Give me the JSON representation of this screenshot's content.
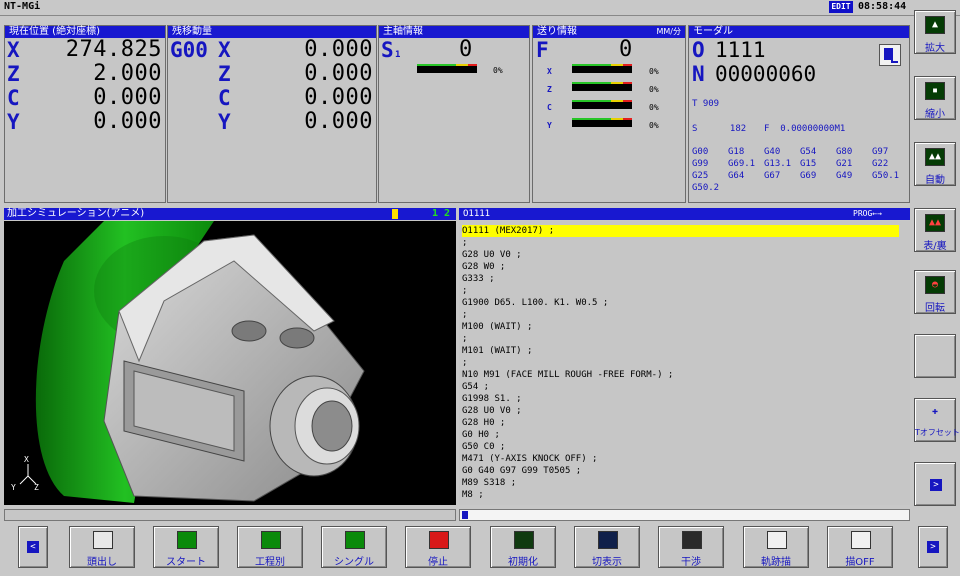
{
  "titlebar": {
    "app_name": "NT-MGi",
    "mode_badge": "EDIT",
    "clock": "08:58:44"
  },
  "position": {
    "title": "現在位置 (絶対座標)",
    "axes": [
      {
        "label": "X",
        "value": "274.825"
      },
      {
        "label": "Z",
        "value": "2.000"
      },
      {
        "label": "C",
        "value": "0.000"
      },
      {
        "label": "Y",
        "value": "0.000"
      }
    ]
  },
  "distance": {
    "title": "残移動量",
    "gcode": "G00",
    "axes": [
      {
        "label": "X",
        "value": "0.000"
      },
      {
        "label": "Z",
        "value": "0.000"
      },
      {
        "label": "C",
        "value": "0.000"
      },
      {
        "label": "Y",
        "value": "0.000"
      }
    ]
  },
  "spindle": {
    "title": "主軸情報",
    "label": "S",
    "subscript": "1",
    "value": "0",
    "load_percent": "0%"
  },
  "feed": {
    "title": "送り情報",
    "unit": "MM/分",
    "label": "F",
    "value": "0",
    "axes": [
      {
        "label": "X",
        "percent": "0%"
      },
      {
        "label": "Z",
        "percent": "0%"
      },
      {
        "label": "C",
        "percent": "0%"
      },
      {
        "label": "Y",
        "percent": "0%"
      }
    ]
  },
  "modal": {
    "title": "モーダル",
    "o_label": "O",
    "o_value": "1111",
    "n_label": "N",
    "n_value": "00000060",
    "t_line": "T  909",
    "s_line": "S      182",
    "f_line": "F  0.00000000M1",
    "gcodes": [
      [
        "G00",
        "G18",
        "G40",
        "G54",
        "G80",
        "G97"
      ],
      [
        "G99",
        "G69.1",
        "G13.1",
        "G15",
        "G21",
        "G22"
      ],
      [
        "G25",
        "G64",
        "G67",
        "G69",
        "G49",
        "G50.1"
      ],
      [
        "G50.2"
      ]
    ]
  },
  "simulation": {
    "title": "加工シミュレーション(アニメ)",
    "indicator": "1 2",
    "axis_x": "X",
    "axis_y": "Y",
    "axis_z": "Z"
  },
  "program": {
    "title": "O1111",
    "mode": "PROG←→",
    "lines": [
      "O1111 (MEX2017) ;",
      ";",
      "G28 U0 V0 ;",
      "G28 W0 ;",
      "G333 ;",
      ";",
      "G1900 D65. L100. K1. W0.5 ;",
      ";",
      "M100 (WAIT) ;",
      ";",
      "M101 (WAIT) ;",
      ";",
      "N10 M91 (FACE MILL ROUGH -FREE FORM-) ;",
      "G54 ;",
      "G1998 S1. ;",
      "G28 U0 V0 ;",
      "G28 H0 ;",
      "G0 H0 ;",
      "G50 C0 ;",
      "M471 (Y-AXIS KNOCK OFF) ;",
      "G0 G40 G97 G99 T0505 ;",
      "M89 S318 ;",
      "M8 ;"
    ]
  },
  "side_buttons": [
    {
      "label": "拡大",
      "icon": "zoom-in-icon"
    },
    {
      "label": "縮小",
      "icon": "zoom-out-icon"
    },
    {
      "label": "自動",
      "icon": "auto-icon"
    },
    {
      "label": "表/裏",
      "icon": "front-back-icon"
    },
    {
      "label": "回転",
      "icon": "rotate-icon"
    },
    {
      "label": "",
      "icon": ""
    },
    {
      "label": "Tオフセット",
      "icon": "tool-offset-icon"
    },
    {
      "label": "",
      "icon": "next-arrow-icon"
    }
  ],
  "soft_buttons": [
    {
      "label": "頭出し",
      "icon": "search-head-icon"
    },
    {
      "label": "スタート",
      "icon": "play-icon"
    },
    {
      "label": "工程別",
      "icon": "step-icon"
    },
    {
      "label": "シングル",
      "icon": "single-block-icon"
    },
    {
      "label": "停止",
      "icon": "stop-icon"
    },
    {
      "label": "初期化",
      "icon": "reset-icon"
    },
    {
      "label": "切表示",
      "icon": "cut-display-icon"
    },
    {
      "label": "干渉",
      "icon": "interference-icon"
    },
    {
      "label": "軌跡描",
      "icon": "path-draw-icon"
    },
    {
      "label": "描OFF",
      "icon": "draw-off-icon"
    }
  ]
}
